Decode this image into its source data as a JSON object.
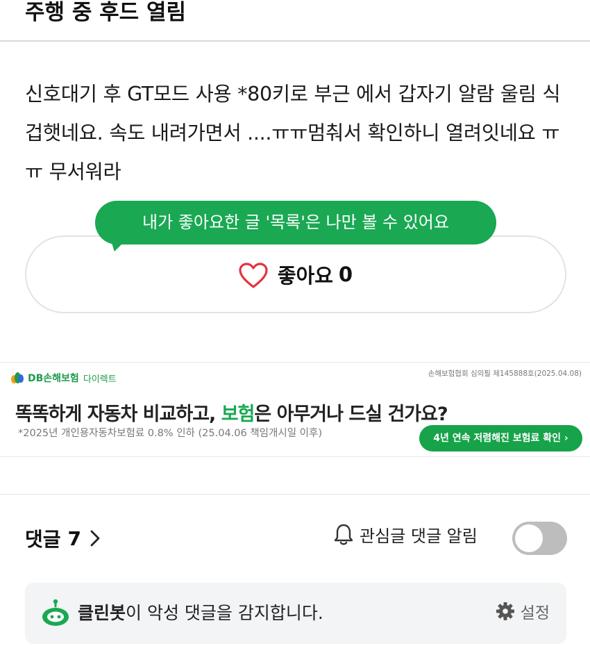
{
  "post": {
    "title": "주행 중 후드 열림",
    "body": "신호대기 후 GT모드 사용 *80키로 부근 에서  갑자기 알람 울림 식겁햇네요. 속도 내려가면서 ....ㅠㅠ멈춰서 확인하니 열려잇네요 ㅠㅠ 무서워라"
  },
  "like": {
    "tooltip": "내가 좋아요한 글 '목록'은 나만 볼 수 있어요",
    "label": "좋아요",
    "count": "0",
    "icon": "heart-icon",
    "icon_color": "#e5333c"
  },
  "ad": {
    "brand": "DB손해보험",
    "brand_sub": "다이렉트",
    "approval": "손해보험협회 심의필 제145888호(2025.04.08)",
    "headline_part1": "똑똑하게 자동차 비교하고, ",
    "headline_highlight": "보험",
    "headline_part2": "은 아무거나 드실 건가요?",
    "note": "*2025년 개인용자동차보험료 0.8% 인하 (25.04.06 책임개시일 이후)",
    "cta": "4년 연속 저렴해진 보험료 확인 ›",
    "accent_color": "#1aa853"
  },
  "comments": {
    "label": "댓글",
    "count": "7",
    "notify_label": "관심글 댓글 알림",
    "notify_enabled": false
  },
  "cleanbot": {
    "name": "클린봇",
    "message": "이 악성 댓글을 감지합니다.",
    "settings_label": "설정"
  },
  "colors": {
    "brand_green": "#1aa853",
    "toggle_off": "#bdbdbd",
    "panel_bg": "#f3f4f6"
  }
}
